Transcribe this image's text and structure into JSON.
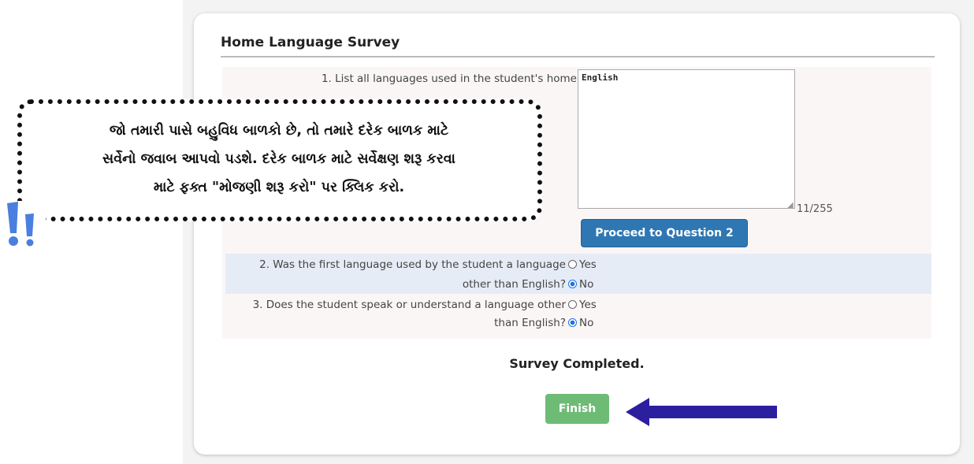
{
  "survey": {
    "title": "Home Language Survey",
    "q1": {
      "label": "1. List all languages used in the student's home",
      "value": "English",
      "char_count": "11/255"
    },
    "proceed_label": "Proceed to Question 2",
    "q2": {
      "line1": "2. Was the first language used by the student a language",
      "line2": "other than English?",
      "yes": "Yes",
      "no": "No",
      "selected": "No"
    },
    "q3": {
      "line1": "3. Does the student speak or understand a language other",
      "line2": "than English?",
      "yes": "Yes",
      "no": "No",
      "selected": "No"
    },
    "completed": "Survey Completed.",
    "finish_label": "Finish"
  },
  "callout": {
    "line1": "જો તમારી પાસે બહુવિધ બાળકો છે, તો તમારે દરેક બાળક માટે",
    "line2": "સર્વેનો જવાબ આપવો પડશે. દરેક બાળક માટે સર્વેક્ષણ શરૂ કરવા",
    "line3": "માટે ફક્ત \"મોજણી શરૂ કરો\" પર ક્લિક કરો."
  },
  "colors": {
    "proceed_button": "#2f77b3",
    "finish_button": "#6ebb75",
    "arrow": "#2b1fa0",
    "exclamation": "#4a7fe0",
    "highlight_row": "#e5ecf6"
  },
  "icons": {
    "arrow": "left-arrow-icon",
    "exclamation": "double-exclamation-icon"
  }
}
